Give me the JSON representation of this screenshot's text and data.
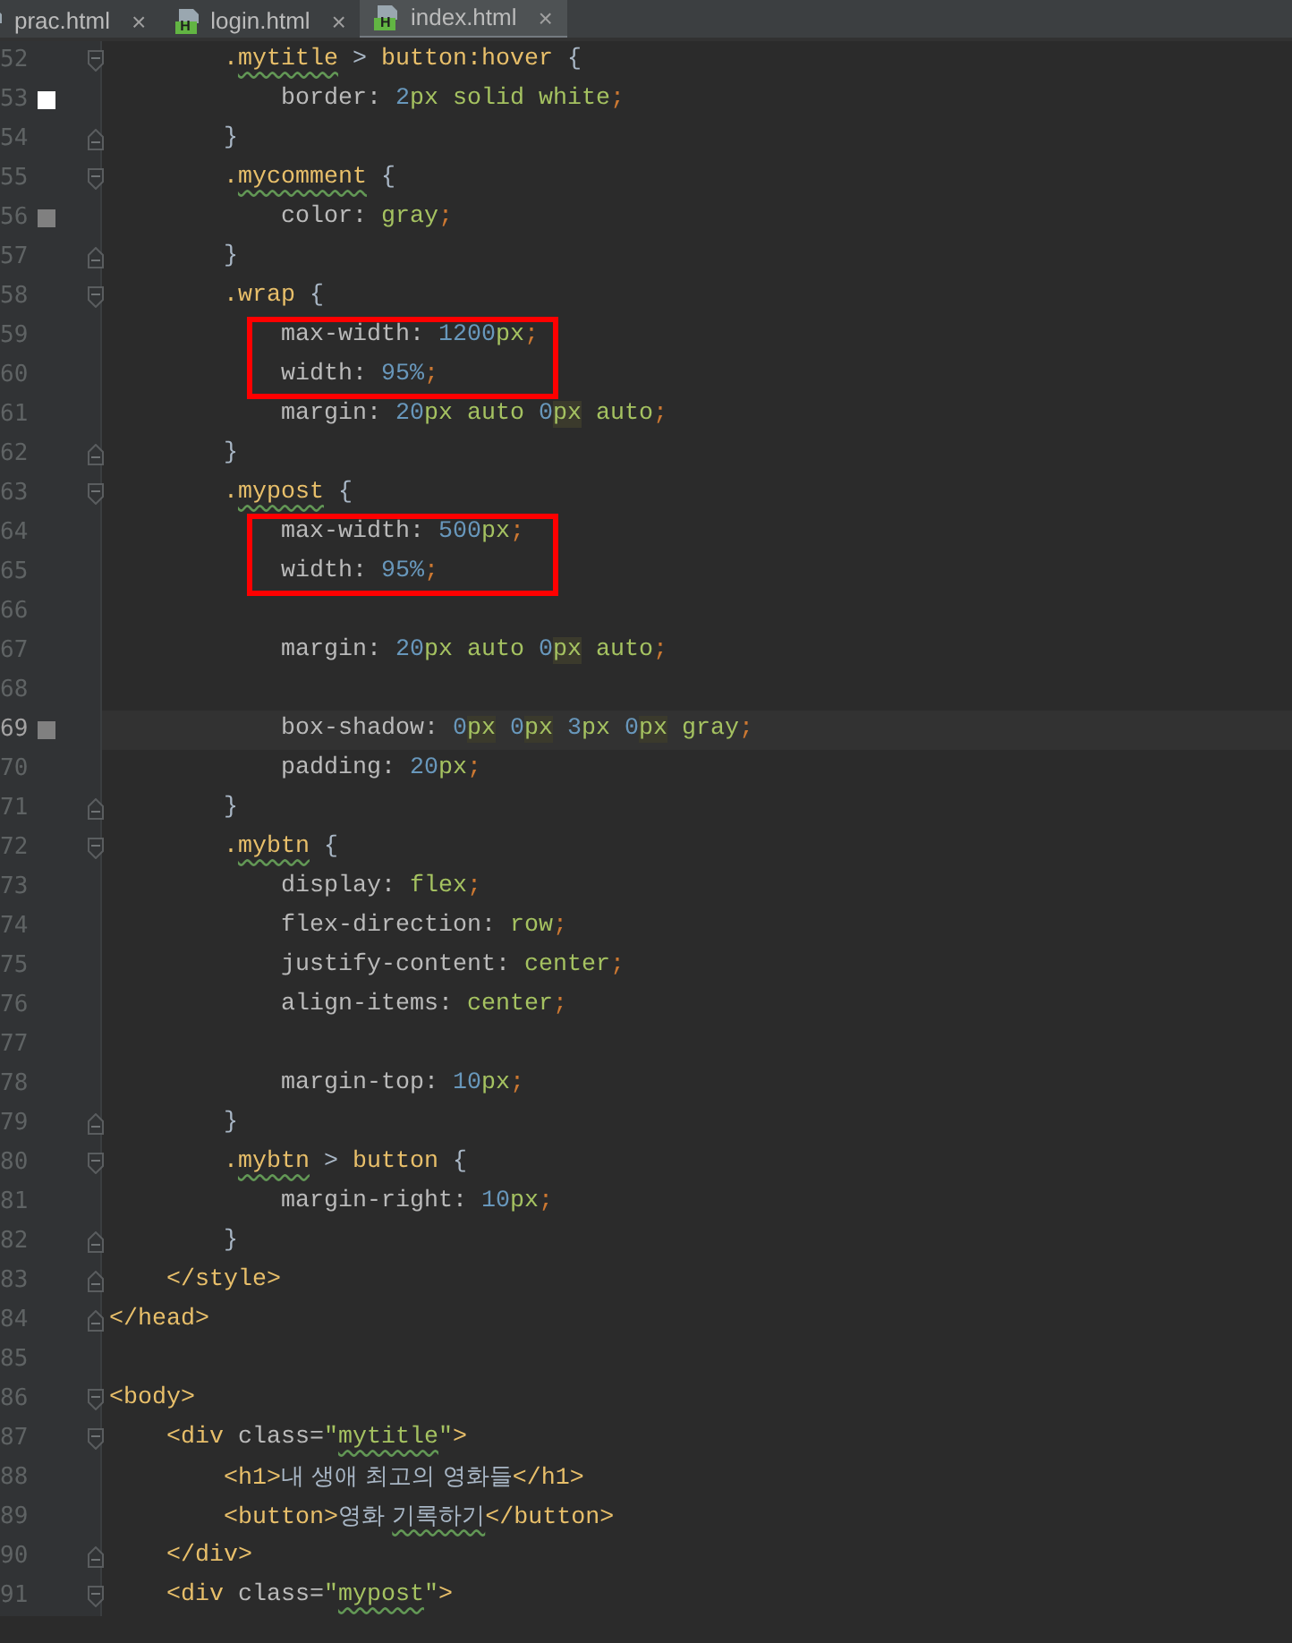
{
  "tabs": [
    {
      "label": "prac.html",
      "close": "×",
      "selected": false
    },
    {
      "label": "login.html",
      "icon_letter": "H",
      "close": "×",
      "selected": false
    },
    {
      "label": "index.html",
      "icon_letter": "H",
      "close": "×",
      "selected": true
    }
  ],
  "segments": [
    {
      "kind": "plain",
      "lines": [
        {
          "number": "52",
          "fold_start": true,
          "fold_end": false,
          "current": false,
          "tokens": [
            {
              "kind": "sel",
              "text": "        ."
            },
            {
              "kind": "sel_typo",
              "text": "mytitle"
            },
            {
              "kind": "plain",
              "text": " > "
            },
            {
              "kind": "sel",
              "text": "button:hover"
            },
            {
              "kind": "plain",
              "text": " {"
            }
          ]
        },
        {
          "number": "53",
          "fold_start": false,
          "fold_end": false,
          "current": false,
          "marker": {
            "color": "#ffffff"
          },
          "tokens": [
            {
              "kind": "prop",
              "text": "            border: "
            },
            {
              "kind": "num",
              "text": "2"
            },
            {
              "kind": "unit",
              "text": "px"
            },
            {
              "kind": "val",
              "text": " solid white"
            },
            {
              "kind": "semi",
              "text": ";"
            }
          ]
        },
        {
          "number": "54",
          "fold_start": false,
          "fold_end": true,
          "current": false,
          "tokens": [
            {
              "kind": "plain",
              "text": "        }"
            }
          ]
        },
        {
          "number": "55",
          "fold_start": true,
          "fold_end": false,
          "current": false,
          "tokens": [
            {
              "kind": "sel",
              "text": "        ."
            },
            {
              "kind": "sel_typo",
              "text": "mycomment"
            },
            {
              "kind": "plain",
              "text": " {"
            }
          ]
        },
        {
          "number": "56",
          "fold_start": false,
          "fold_end": false,
          "current": false,
          "marker": {
            "color": "#808080"
          },
          "tokens": [
            {
              "kind": "prop",
              "text": "            color: "
            },
            {
              "kind": "val",
              "text": "gray"
            },
            {
              "kind": "semi",
              "text": ";"
            }
          ]
        },
        {
          "number": "57",
          "fold_start": false,
          "fold_end": true,
          "current": false,
          "tokens": [
            {
              "kind": "plain",
              "text": "        }"
            }
          ]
        },
        {
          "number": "58",
          "fold_start": true,
          "fold_end": false,
          "current": false,
          "tokens": [
            {
              "kind": "sel",
              "text": "        .wrap"
            },
            {
              "kind": "plain",
              "text": " {"
            }
          ]
        }
      ]
    },
    {
      "kind": "boxed",
      "lines": [
        {
          "number": "59",
          "fold_start": false,
          "fold_end": false,
          "current": false,
          "tokens": [
            {
              "kind": "prop",
              "text": "            max-width: "
            },
            {
              "kind": "num",
              "text": "1200"
            },
            {
              "kind": "unit",
              "text": "px"
            },
            {
              "kind": "semi",
              "text": ";"
            }
          ]
        },
        {
          "number": "60",
          "fold_start": false,
          "fold_end": false,
          "current": false,
          "tokens": [
            {
              "kind": "prop",
              "text": "            width: "
            },
            {
              "kind": "num",
              "text": "95%"
            },
            {
              "kind": "semi",
              "text": ";"
            }
          ]
        }
      ]
    },
    {
      "kind": "plain",
      "lines": [
        {
          "number": "61",
          "fold_start": false,
          "fold_end": false,
          "current": false,
          "tokens": [
            {
              "kind": "prop",
              "text": "            margin: "
            },
            {
              "kind": "num",
              "text": "20"
            },
            {
              "kind": "unit",
              "text": "px"
            },
            {
              "kind": "val",
              "text": " auto "
            },
            {
              "kind": "num",
              "text": "0"
            },
            {
              "kind": "unit_hl",
              "text": "px"
            },
            {
              "kind": "val",
              "text": " auto"
            },
            {
              "kind": "semi",
              "text": ";"
            }
          ]
        },
        {
          "number": "62",
          "fold_start": false,
          "fold_end": true,
          "current": false,
          "tokens": [
            {
              "kind": "plain",
              "text": "        }"
            }
          ]
        },
        {
          "number": "63",
          "fold_start": true,
          "fold_end": false,
          "current": false,
          "tokens": [
            {
              "kind": "sel",
              "text": "        ."
            },
            {
              "kind": "sel_typo",
              "text": "mypost"
            },
            {
              "kind": "plain",
              "text": " {"
            }
          ]
        }
      ]
    },
    {
      "kind": "boxed",
      "lines": [
        {
          "number": "64",
          "fold_start": false,
          "fold_end": false,
          "current": false,
          "tokens": [
            {
              "kind": "prop",
              "text": "            max-width: "
            },
            {
              "kind": "num",
              "text": "500"
            },
            {
              "kind": "unit",
              "text": "px"
            },
            {
              "kind": "semi",
              "text": ";"
            }
          ]
        },
        {
          "number": "65",
          "fold_start": false,
          "fold_end": false,
          "current": false,
          "tokens": [
            {
              "kind": "prop",
              "text": "            width: "
            },
            {
              "kind": "num",
              "text": "95%"
            },
            {
              "kind": "semi",
              "text": ";"
            }
          ]
        }
      ]
    },
    {
      "kind": "plain",
      "lines": [
        {
          "number": "66",
          "fold_start": false,
          "fold_end": false,
          "current": false
        },
        {
          "number": "67",
          "fold_start": false,
          "fold_end": false,
          "current": false,
          "tokens": [
            {
              "kind": "prop",
              "text": "            margin: "
            },
            {
              "kind": "num",
              "text": "20"
            },
            {
              "kind": "unit",
              "text": "px"
            },
            {
              "kind": "val",
              "text": " auto "
            },
            {
              "kind": "num",
              "text": "0"
            },
            {
              "kind": "unit_hl",
              "text": "px"
            },
            {
              "kind": "val",
              "text": " auto"
            },
            {
              "kind": "semi",
              "text": ";"
            }
          ]
        },
        {
          "number": "68",
          "fold_start": false,
          "fold_end": false,
          "current": false
        },
        {
          "number": "69",
          "fold_start": false,
          "fold_end": false,
          "current": true,
          "marker": {
            "color": "#808080"
          },
          "tokens": [
            {
              "kind": "prop",
              "text": "            box-shadow: "
            },
            {
              "kind": "num",
              "text": "0"
            },
            {
              "kind": "unit_hl",
              "text": "px"
            },
            {
              "kind": "num",
              "text": " 0"
            },
            {
              "kind": "unit_hl",
              "text": "px"
            },
            {
              "kind": "num",
              "text": " 3"
            },
            {
              "kind": "unit",
              "text": "px"
            },
            {
              "kind": "num",
              "text": " 0"
            },
            {
              "kind": "unit_hl",
              "text": "px"
            },
            {
              "kind": "val",
              "text": " gray"
            },
            {
              "kind": "semi",
              "text": ";"
            }
          ]
        },
        {
          "number": "70",
          "fold_start": false,
          "fold_end": false,
          "current": false,
          "tokens": [
            {
              "kind": "prop",
              "text": "            padding: "
            },
            {
              "kind": "num",
              "text": "20"
            },
            {
              "kind": "unit",
              "text": "px"
            },
            {
              "kind": "semi",
              "text": ";"
            }
          ]
        },
        {
          "number": "71",
          "fold_start": false,
          "fold_end": true,
          "current": false,
          "tokens": [
            {
              "kind": "plain",
              "text": "        }"
            }
          ]
        },
        {
          "number": "72",
          "fold_start": true,
          "fold_end": false,
          "current": false,
          "tokens": [
            {
              "kind": "sel",
              "text": "        ."
            },
            {
              "kind": "sel_typo",
              "text": "mybtn"
            },
            {
              "kind": "plain",
              "text": " {"
            }
          ]
        },
        {
          "number": "73",
          "fold_start": false,
          "fold_end": false,
          "current": false,
          "tokens": [
            {
              "kind": "prop",
              "text": "            display: "
            },
            {
              "kind": "val",
              "text": "flex"
            },
            {
              "kind": "semi",
              "text": ";"
            }
          ]
        },
        {
          "number": "74",
          "fold_start": false,
          "fold_end": false,
          "current": false,
          "tokens": [
            {
              "kind": "prop",
              "text": "            flex-direction: "
            },
            {
              "kind": "val",
              "text": "row"
            },
            {
              "kind": "semi",
              "text": ";"
            }
          ]
        },
        {
          "number": "75",
          "fold_start": false,
          "fold_end": false,
          "current": false,
          "tokens": [
            {
              "kind": "prop",
              "text": "            justify-content: "
            },
            {
              "kind": "val",
              "text": "center"
            },
            {
              "kind": "semi",
              "text": ";"
            }
          ]
        },
        {
          "number": "76",
          "fold_start": false,
          "fold_end": false,
          "current": false,
          "tokens": [
            {
              "kind": "prop",
              "text": "            align-items: "
            },
            {
              "kind": "val",
              "text": "center"
            },
            {
              "kind": "semi",
              "text": ";"
            }
          ]
        },
        {
          "number": "77",
          "fold_start": false,
          "fold_end": false,
          "current": false
        },
        {
          "number": "78",
          "fold_start": false,
          "fold_end": false,
          "current": false,
          "tokens": [
            {
              "kind": "prop",
              "text": "            margin-top: "
            },
            {
              "kind": "num",
              "text": "10"
            },
            {
              "kind": "unit",
              "text": "px"
            },
            {
              "kind": "semi",
              "text": ";"
            }
          ]
        },
        {
          "number": "79",
          "fold_start": false,
          "fold_end": true,
          "current": false,
          "tokens": [
            {
              "kind": "plain",
              "text": "        }"
            }
          ]
        },
        {
          "number": "80",
          "fold_start": true,
          "fold_end": false,
          "current": false,
          "tokens": [
            {
              "kind": "sel",
              "text": "        ."
            },
            {
              "kind": "sel_typo",
              "text": "mybtn"
            },
            {
              "kind": "plain",
              "text": " > "
            },
            {
              "kind": "sel",
              "text": "button"
            },
            {
              "kind": "plain",
              "text": " {"
            }
          ]
        },
        {
          "number": "81",
          "fold_start": false,
          "fold_end": false,
          "current": false,
          "tokens": [
            {
              "kind": "prop",
              "text": "            margin-right: "
            },
            {
              "kind": "num",
              "text": "10"
            },
            {
              "kind": "unit",
              "text": "px"
            },
            {
              "kind": "semi",
              "text": ";"
            }
          ]
        },
        {
          "number": "82",
          "fold_start": false,
          "fold_end": true,
          "current": false,
          "tokens": [
            {
              "kind": "plain",
              "text": "        }"
            }
          ]
        },
        {
          "number": "83",
          "fold_start": false,
          "fold_end": true,
          "current": false,
          "tokens": [
            {
              "kind": "tag",
              "text": "    </style>"
            }
          ]
        },
        {
          "number": "84",
          "fold_start": false,
          "fold_end": true,
          "current": false,
          "tokens": [
            {
              "kind": "tag",
              "text": "</head>"
            }
          ]
        },
        {
          "number": "85",
          "fold_start": false,
          "fold_end": false,
          "current": false
        },
        {
          "number": "86",
          "fold_start": true,
          "fold_end": false,
          "current": false,
          "tokens": [
            {
              "kind": "tag",
              "text": "<body>"
            }
          ]
        },
        {
          "number": "87",
          "fold_start": true,
          "fold_end": false,
          "current": false,
          "tokens": [
            {
              "kind": "tag",
              "text": "    <div "
            },
            {
              "kind": "attr",
              "text": "class="
            },
            {
              "kind": "str",
              "text": "\""
            },
            {
              "kind": "str_typo",
              "text": "mytitle"
            },
            {
              "kind": "str",
              "text": "\""
            },
            {
              "kind": "tag",
              "text": ">"
            }
          ]
        },
        {
          "number": "88",
          "fold_start": false,
          "fold_end": false,
          "current": false,
          "tokens": [
            {
              "kind": "tag",
              "text": "        <h1>"
            },
            {
              "kind": "text",
              "text": "내 생애 최고의 영화들"
            },
            {
              "kind": "tag",
              "text": "</h1>"
            }
          ]
        },
        {
          "number": "89",
          "fold_start": false,
          "fold_end": false,
          "current": false,
          "tokens": [
            {
              "kind": "tag",
              "text": "        <button>"
            },
            {
              "kind": "text",
              "text": "영화 "
            },
            {
              "kind": "text_typo",
              "text": "기록하기"
            },
            {
              "kind": "tag",
              "text": "</button>"
            }
          ]
        },
        {
          "number": "90",
          "fold_start": false,
          "fold_end": true,
          "current": false,
          "tokens": [
            {
              "kind": "tag",
              "text": "    </div>"
            }
          ]
        },
        {
          "number": "91",
          "fold_start": true,
          "fold_end": false,
          "current": false,
          "tokens": [
            {
              "kind": "tag",
              "text": "    <div "
            },
            {
              "kind": "attr",
              "text": "class="
            },
            {
              "kind": "str",
              "text": "\""
            },
            {
              "kind": "str_typo",
              "text": "mypost"
            },
            {
              "kind": "str",
              "text": "\""
            },
            {
              "kind": "tag",
              "text": ">"
            }
          ]
        }
      ]
    }
  ]
}
